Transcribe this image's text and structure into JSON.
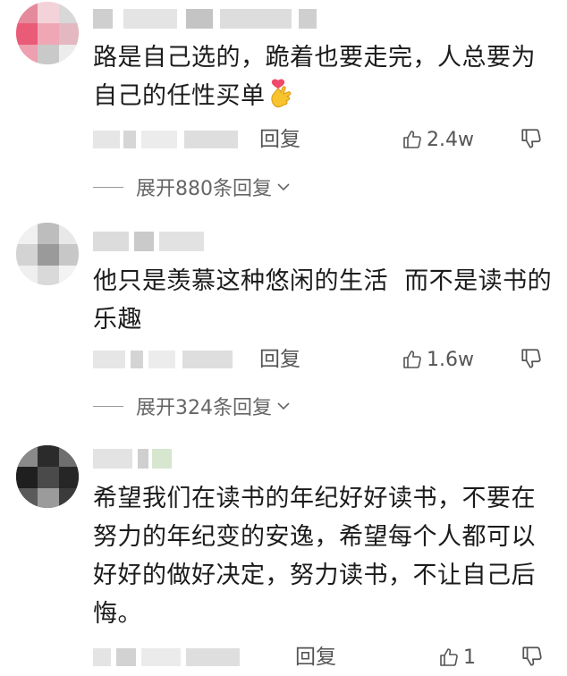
{
  "comments": [
    {
      "text": "路是自己选的，跪着也要走完，人总要为自己的任性买单",
      "emoji": "finger-heart-emoji",
      "reply_label": "回复",
      "likes": "2.4w",
      "expand_label": "展开880条回复"
    },
    {
      "text": "他只是羡慕这种悠闲的生活  而不是读书的乐趣",
      "reply_label": "回复",
      "likes": "1.6w",
      "expand_label": "展开324条回复"
    },
    {
      "text": "希望我们在读书的年纪好好读书，不要在努力的年纪变的安逸，希望每个人都可以好好的做好决定，努力读书，不让自己后悔。",
      "reply_label": "回复",
      "likes": "1"
    }
  ],
  "icons": {
    "like": "thumbs-up-icon",
    "dislike": "thumbs-down-icon",
    "expand": "chevron-down-icon"
  },
  "colors": {
    "text": "#1b1b1b",
    "meta": "#555555",
    "blur": "#d9d9d9"
  }
}
